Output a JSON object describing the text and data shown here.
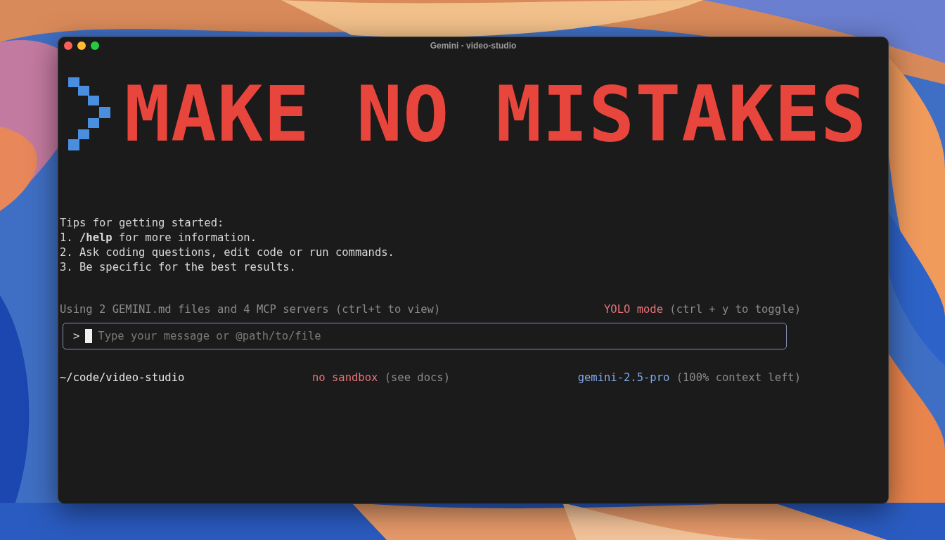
{
  "window": {
    "title": "Gemini - video-studio"
  },
  "banner": {
    "text": "MAKE NO MISTAKES"
  },
  "tips": {
    "heading": "Tips for getting started:",
    "items": [
      "1. **/help** for more information.",
      "2. Ask coding questions, edit code or run commands.",
      "3. Be specific for the best results."
    ]
  },
  "context_info": "Using 2 GEMINI.md files and 4 MCP servers (ctrl+t to view)",
  "mode": {
    "label": "YOLO mode",
    "hint": "(ctrl + y to toggle)"
  },
  "input": {
    "prompt": ">",
    "placeholder": "Type your message or @path/to/file"
  },
  "footer": {
    "path": "~/code/video-studio",
    "sandbox": {
      "label": "no sandbox",
      "hint": "(see docs)"
    },
    "model": {
      "label": "gemini-2.5-pro",
      "hint": "(100% context left)"
    }
  }
}
